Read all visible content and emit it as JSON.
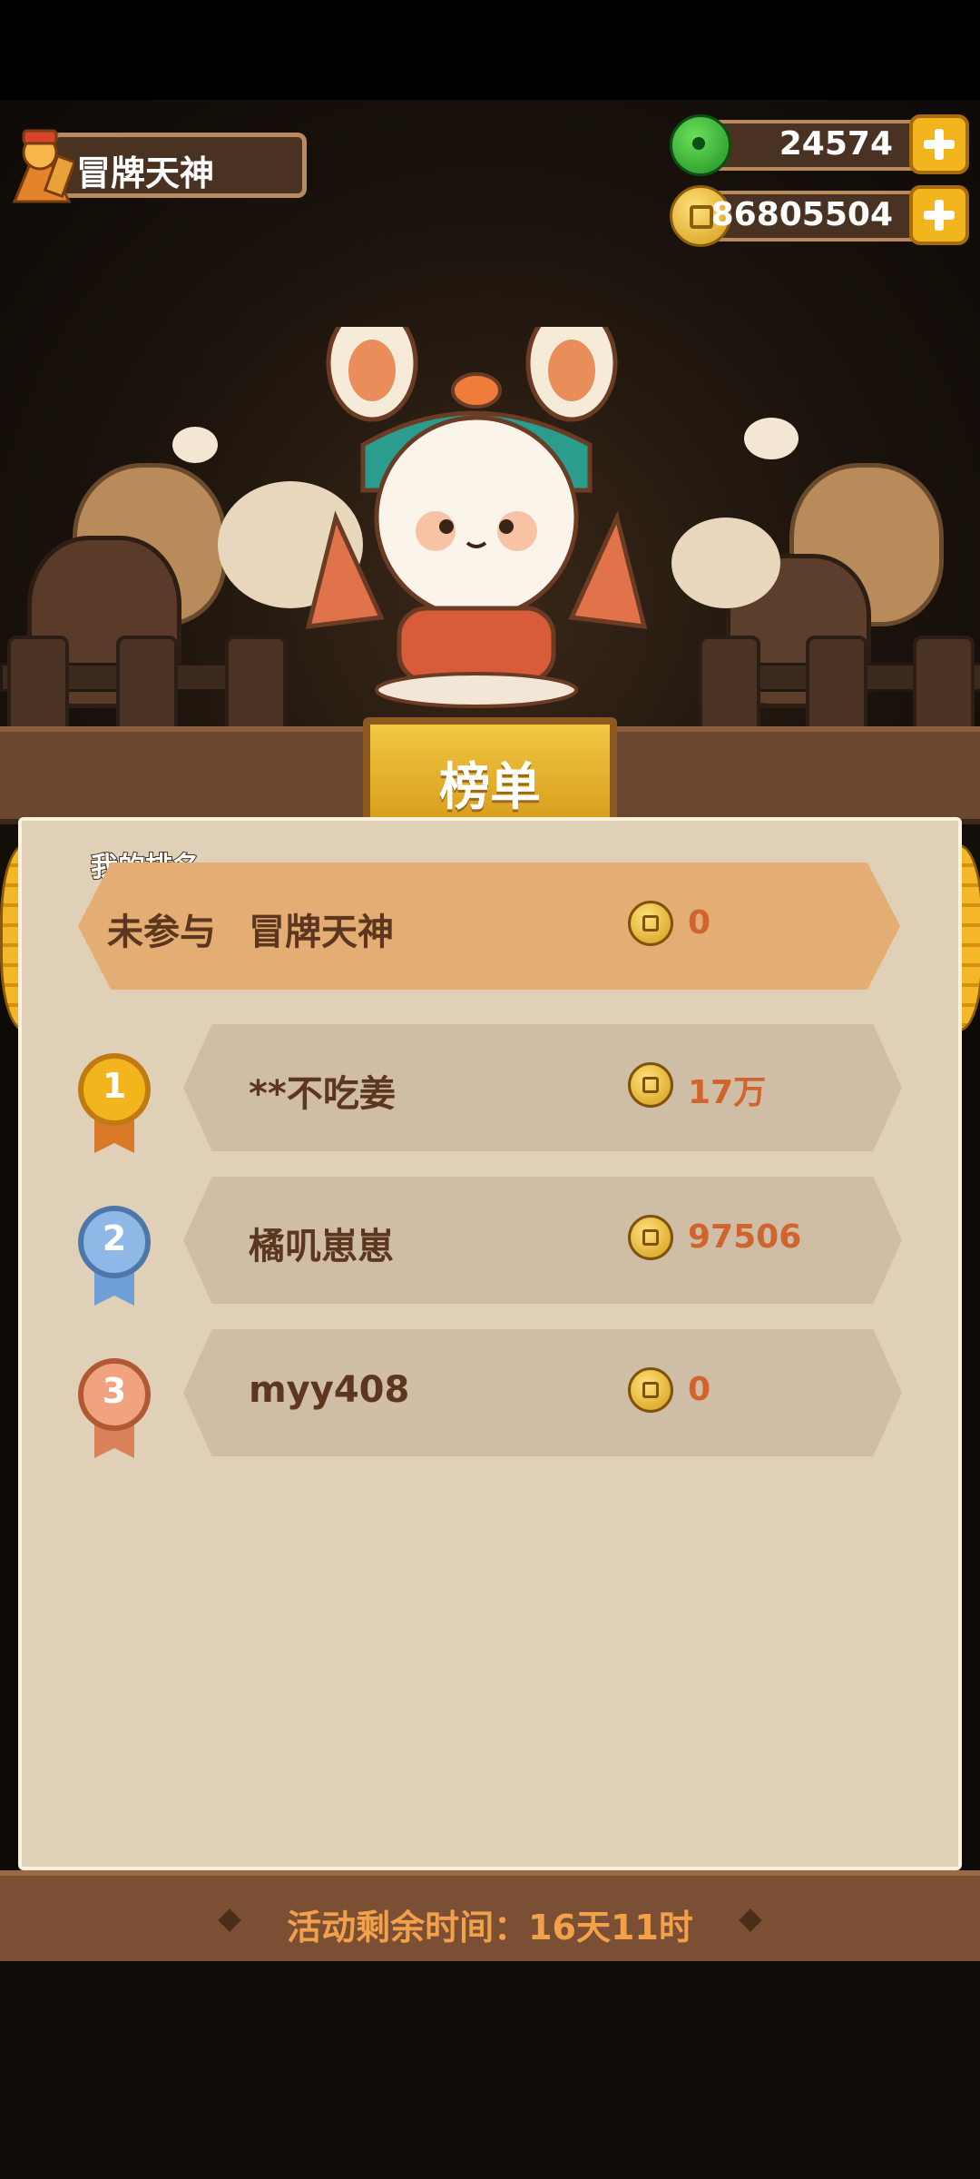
{
  "profile": {
    "name": "冒牌天神",
    "avatar": "avatar-icon"
  },
  "currency": {
    "jade": {
      "value": "24574",
      "icon": "jade-icon"
    },
    "coins": {
      "value": "86805504",
      "icon": "coin-icon"
    }
  },
  "leaderboard": {
    "title": "榜单",
    "my_rank_label": "我的排名",
    "my_rank": {
      "status": "未参与",
      "name": "冒牌天神",
      "value": "0"
    },
    "entries": [
      {
        "rank": "1",
        "name": "**不吃姜",
        "value": "17万"
      },
      {
        "rank": "2",
        "name": "橘叽崽崽",
        "value": "97506"
      },
      {
        "rank": "3",
        "name": "myy408",
        "value": "0"
      }
    ]
  },
  "footer": {
    "remaining": "活动剩余时间：16天11时"
  },
  "colors": {
    "panel": "#e0d0b8",
    "my_row": "#e3ad73",
    "row": "#cfbda6",
    "value": "#d0642c",
    "gold": "#f2b51e"
  }
}
